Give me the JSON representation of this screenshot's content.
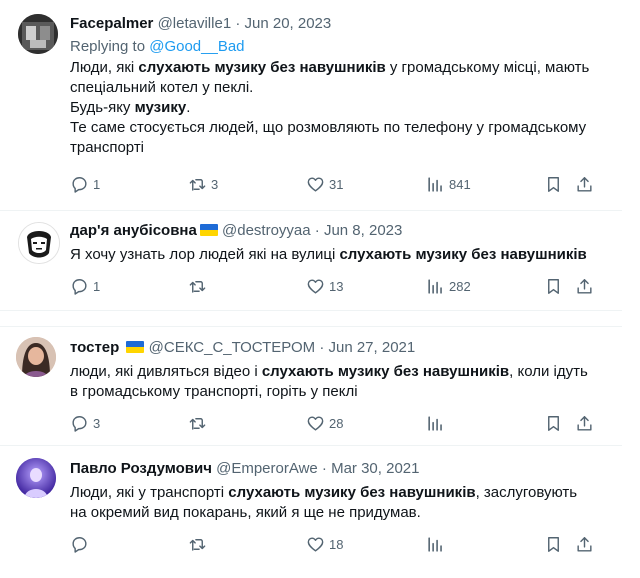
{
  "tweets": [
    {
      "name": "Facepalmer",
      "handle": "@letaville1",
      "sep": "·",
      "date": "Jun 20, 2023",
      "replying_prefix": "Replying to ",
      "replying_handle": "@Good__Bad",
      "lines": [
        {
          "a": "Люди, які ",
          "b": "слухають музику без навушників",
          "c": " у громадському місці, мають"
        },
        {
          "a": "спеціальний котел у пеклі.",
          "b": "",
          "c": ""
        },
        {
          "a": "Будь-яку ",
          "b": "музику",
          "c": "."
        },
        {
          "a": "Те саме стосується людей, що розмовляють по телефону у громадському",
          "b": "",
          "c": ""
        },
        {
          "a": "транспорті",
          "b": "",
          "c": ""
        }
      ],
      "stats": {
        "replies": "1",
        "reposts": "3",
        "likes": "31",
        "views": "841"
      }
    },
    {
      "name": "дар'я анубісовна",
      "handle": "@destroyyaa",
      "sep": "·",
      "date": "Jun 8, 2023",
      "lines": [
        {
          "a": "Я хочу узнать лор людей які на вулиці ",
          "b": "слухають музику без навушників",
          "c": ""
        }
      ],
      "stats": {
        "replies": "1",
        "reposts": "",
        "likes": "13",
        "views": "282"
      }
    },
    {
      "name": "тостер",
      "handle": "@СЕКС_С_ТОСТЕРОМ",
      "sep": "·",
      "date": "Jun 27, 2021",
      "lines": [
        {
          "a": "люди, які дивляться відео і ",
          "b": "слухають музику без навушників",
          "c": ", коли ідуть"
        },
        {
          "a": "в громадському транспорті, горіть у пеклі",
          "b": "",
          "c": ""
        }
      ],
      "stats": {
        "replies": "3",
        "reposts": "",
        "likes": "28",
        "views": ""
      }
    },
    {
      "name": "Павло Роздумович",
      "handle": "@EmperorAwe",
      "sep": "·",
      "date": "Mar 30, 2021",
      "lines": [
        {
          "a": "Люди, які у транспорті ",
          "b": "слухають музику без навушників",
          "c": ", заслуговують"
        },
        {
          "a": "на окремий вид покарань, який я ще не придумав.",
          "b": "",
          "c": ""
        }
      ],
      "stats": {
        "replies": "",
        "reposts": "",
        "likes": "18",
        "views": ""
      }
    }
  ],
  "icons": {
    "reply": "reply-icon",
    "repost": "repost-icon",
    "like": "like-icon",
    "views": "views-icon",
    "bookmark": "bookmark-icon",
    "share": "share-icon"
  },
  "colors": {
    "text": "#0f1419",
    "muted": "#536471",
    "accent": "#1d9bf0",
    "divider": "#eff3f4"
  }
}
